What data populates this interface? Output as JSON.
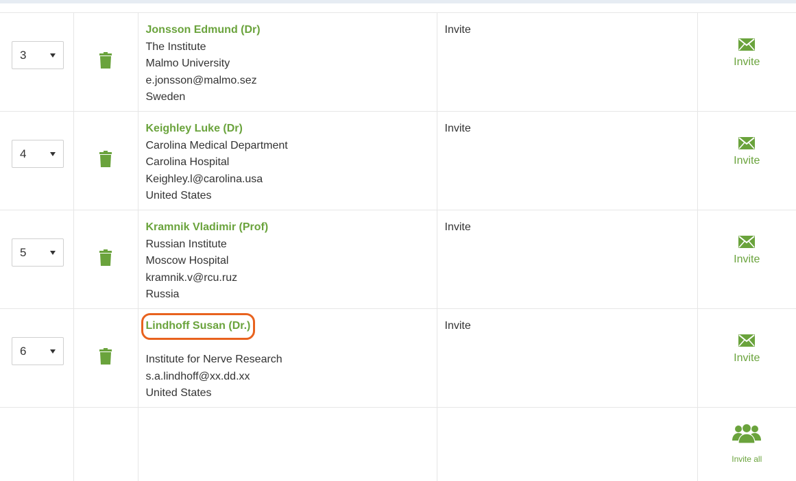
{
  "colors": {
    "accent": "#6aa33c",
    "highlight": "#e8621e"
  },
  "rows": [
    {
      "order": "3",
      "name": "Jonsson Edmund (Dr)",
      "details": [
        "The Institute",
        "Malmo University",
        "e.jonsson@malmo.sez",
        "Sweden"
      ],
      "status": "Invite",
      "action_label": "Invite",
      "action_icon": "envelope-icon"
    },
    {
      "order": "4",
      "name": "Keighley Luke (Dr)",
      "details": [
        "Carolina Medical Department",
        "Carolina Hospital",
        "Keighley.l@carolina.usa",
        "United States"
      ],
      "status": "Invite",
      "action_label": "Invite",
      "action_icon": "envelope-icon"
    },
    {
      "order": "5",
      "name": "Kramnik Vladimir (Prof)",
      "details": [
        "Russian Institute",
        "Moscow Hospital",
        "kramnik.v@rcu.ruz",
        "Russia"
      ],
      "status": "Invite",
      "action_label": "Invite",
      "action_icon": "envelope-icon"
    },
    {
      "order": "6",
      "name": "Lindhoff Susan (Dr.)",
      "details": [
        "",
        "Institute for Nerve Research",
        "s.a.lindhoff@xx.dd.xx",
        "United States"
      ],
      "status": "Invite",
      "action_label": "Invite",
      "action_icon": "envelope-icon"
    }
  ],
  "footer": {
    "invite_all_label": "Invite all",
    "invite_all_icon": "users-group-icon"
  }
}
